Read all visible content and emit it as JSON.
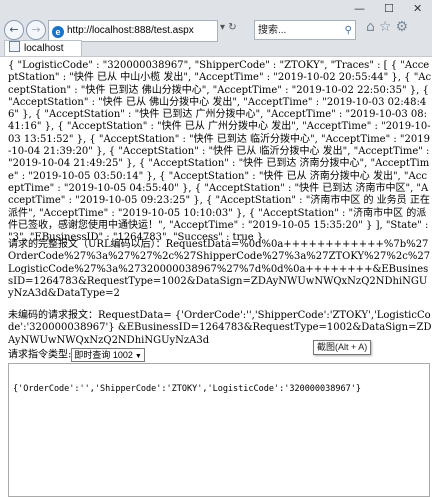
{
  "browser": {
    "window_controls": [
      "—",
      "☐",
      "✕"
    ],
    "url": "http://localhost:888/test.aspx",
    "address_buttons": "▾ ↻",
    "search_placeholder": "搜索...",
    "tab_title": "localhost"
  },
  "page": {
    "traces_json": "{ \"LogisticCode\" : \"320000038967\", \"ShipperCode\" : \"ZTOKY\", \"Traces\" : [ { \"AcceptStation\" : \"快件 已从 中山小榄 发出\", \"AcceptTime\" : \"2019-10-02 20:55:44\" }, { \"AcceptStation\" : \"快件 已到达 佛山分拨中心\", \"AcceptTime\" : \"2019-10-02 22:50:35\" }, { \"AcceptStation\" : \"快件 已从 佛山分拨中心 发出\", \"AcceptTime\" : \"2019-10-03 02:48:46\" }, { \"AcceptStation\" : \"快件 已到达 广州分拨中心\", \"AcceptTime\" : \"2019-10-03 08:41:16\" }, { \"AcceptStation\" : \"快件 已从 广州分拨中心 发出\", \"AcceptTime\" : \"2019-10-03 13:51:52\" }, { \"AcceptStation\" : \"快件 已到达 临沂分拨中心\", \"AcceptTime\" : \"2019-10-04 21:39:20\" }, { \"AcceptStation\" : \"快件 已从 临沂分拨中心 发出\", \"AcceptTime\" : \"2019-10-04 21:49:25\" }, { \"AcceptStation\" : \"快件 已到达 济南分拨中心\", \"AcceptTime\" : \"2019-10-05 03:50:14\" }, { \"AcceptStation\" : \"快件 已从 济南分拨中心 发出\", \"AcceptTime\" : \"2019-10-05 04:55:40\" }, { \"AcceptStation\" : \"快件 已到达 济南市中区\", \"AcceptTime\" : \"2019-10-05 09:23:25\" }, { \"AcceptStation\" : \"济南市中区 的 业务员 正在派件\", \"AcceptTime\" : \"2019-10-05 10:10:03\" }, { \"AcceptStation\" : \"济南市中区 的派件已签收，感谢您使用中通快运！\", \"AcceptTime\" : \"2019-10-05 15:35:20\" } ], \"State\" : \"3\", \"EBusinessID\" : \"1264783\", \"Success\" : true }",
    "encoded_label": "请求的完整报文（URL编码以后）：RequestData=%0d%0a++++++++++++%7b%27OrderCode%27%3a%27%27%2c%27ShipperCode%27%3a%27ZTOKY%27%2c%27LogisticCode%27%3a%27320000038967%27%7d%0d%0a++++++++&EBusinessID=1264783&RequestType=1002&DataSign=ZDAyNWUwNWQxNzQ2NDhiNGUyNzA3d&DataType=2",
    "unencoded_label": "未编码的请求报文：RequestData= {'OrderCode':'','ShipperCode':'ZTOKY','LogisticCode':'320000038967'} &EBusinessID=1264783&RequestType=1002&DataSign=ZDAyNWUwNWQxNzQ2NDhiNGUyNzA3d",
    "request_type_label": "请求指令类型:",
    "request_type_value": "即时查询 1002",
    "textarea_content": "{'OrderCode':'','ShipperCode':'ZTOKY','LogisticCode':'320000038967'}",
    "tooltip": "截图(Alt + A)"
  }
}
